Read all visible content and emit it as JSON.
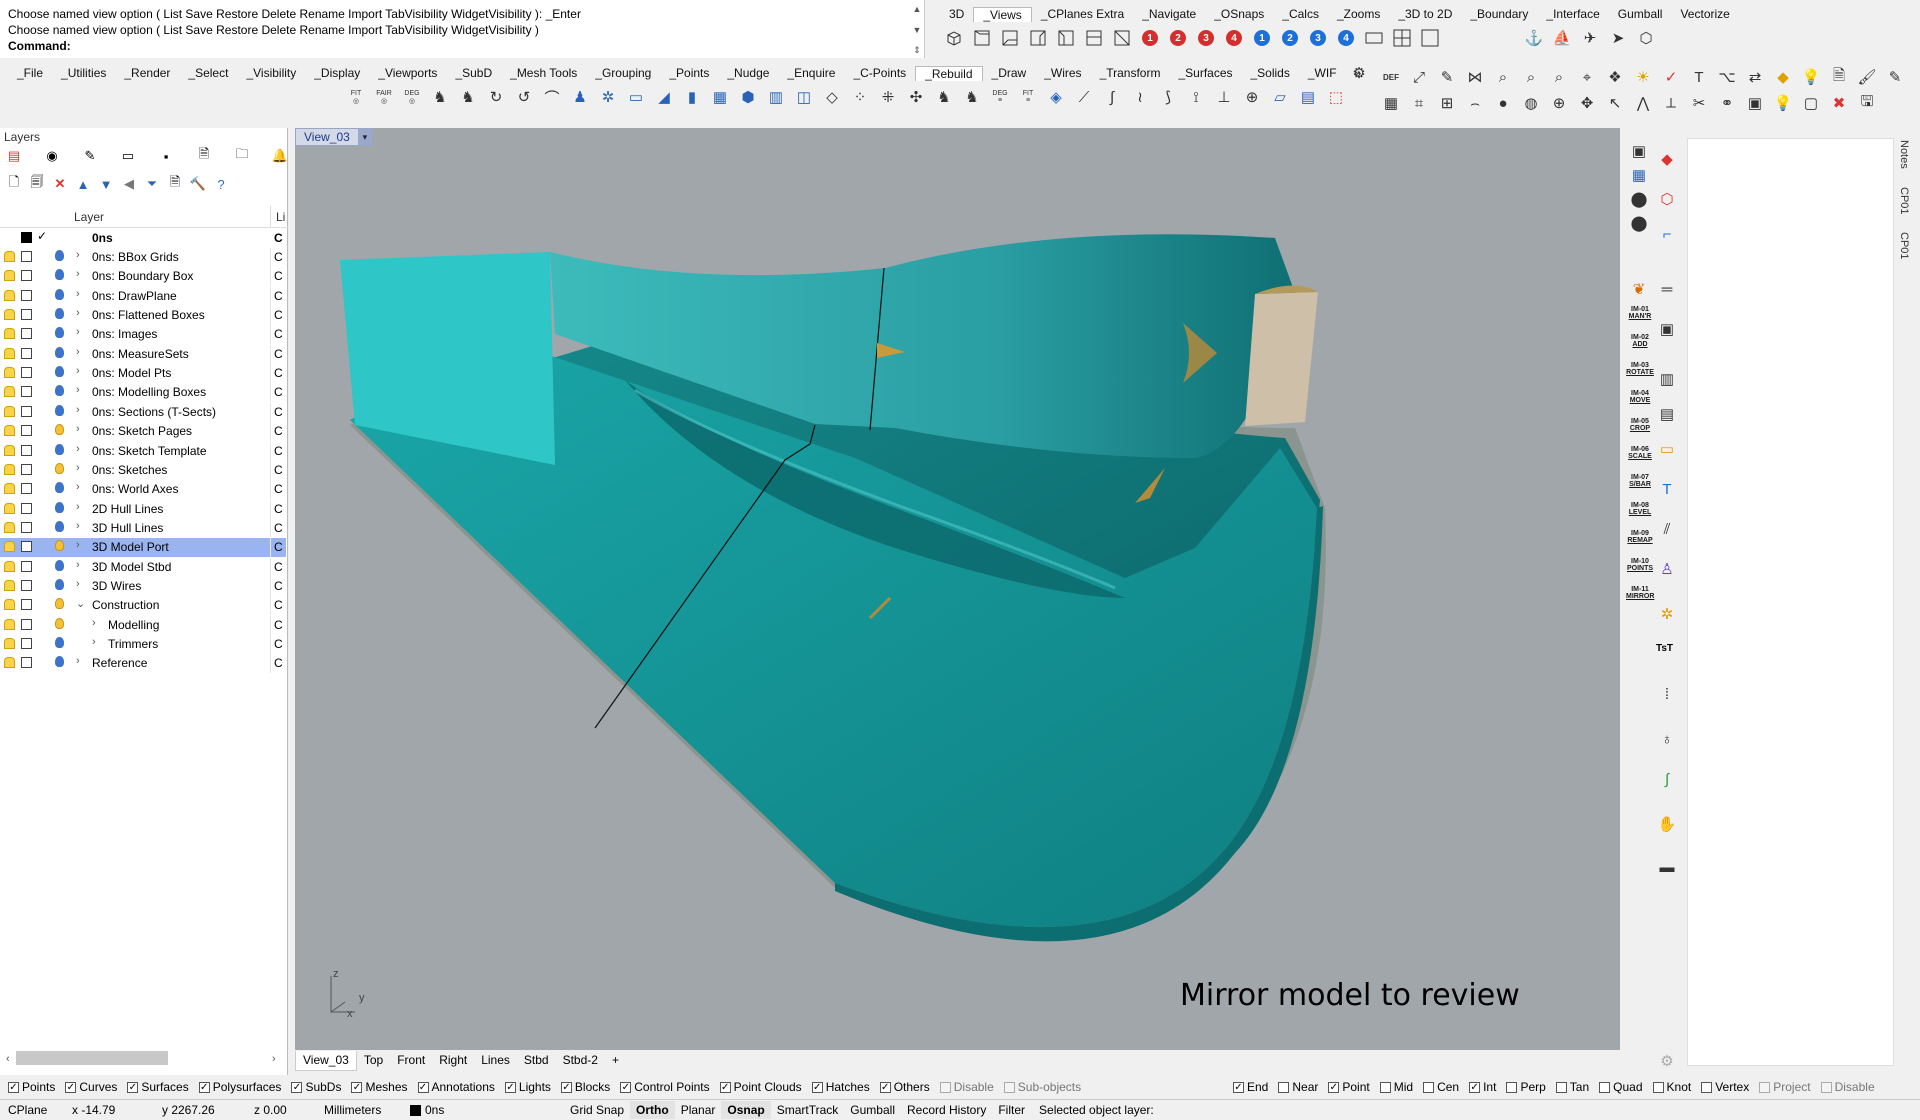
{
  "command": {
    "line1": "Choose named view option ( List  Save  Restore  Delete  Rename  Import  TabVisibility  WidgetVisibility ): _Enter",
    "line2": "Choose named view option ( List  Save  Restore  Delete  Rename  Import  TabVisibility  WidgetVisibility )",
    "prompt": "Command:"
  },
  "top_tabs": [
    "3D",
    "_Views",
    "_CPlanes Extra",
    "_Navigate",
    "_OSnaps",
    "_Calcs",
    "_Zooms",
    "_3D to 2D",
    "_Boundary",
    "_Interface",
    "Gumball",
    "Vectorize"
  ],
  "top_tabs_active": "_Views",
  "main_tabs": [
    "_File",
    "_Utilities",
    "_Render",
    "_Select",
    "_Visibility",
    "_Display",
    "_Viewports",
    "_SubD",
    "_Mesh Tools",
    "_Grouping",
    "_Points",
    "_Nudge",
    "_Enquire",
    "_C-Points",
    "_Rebuild",
    "_Draw",
    "_Wires",
    "_Transform",
    "_Surfaces",
    "_Solids",
    "_WIF"
  ],
  "main_tabs_active": "_Rebuild",
  "toolbar_small_labels": [
    "FIT",
    "FAIR",
    "DEG"
  ],
  "toolbar_labels2": [
    "DEG",
    "FIT"
  ],
  "right_toolbar_label": "DEF",
  "layers": {
    "title": "Layers",
    "col_layer": "Layer",
    "col_material": "Li",
    "current_layer": "0ns",
    "rows": [
      {
        "name": "0ns: BBox Grids",
        "bulb": "blue",
        "indent": 0,
        "exp": "›"
      },
      {
        "name": "0ns: Boundary Box",
        "bulb": "blue",
        "indent": 0,
        "exp": "›"
      },
      {
        "name": "0ns: DrawPlane",
        "bulb": "blue",
        "indent": 0,
        "exp": "›"
      },
      {
        "name": "0ns: Flattened Boxes",
        "bulb": "blue",
        "indent": 0,
        "exp": "›"
      },
      {
        "name": "0ns: Images",
        "bulb": "blue",
        "indent": 0,
        "exp": "›"
      },
      {
        "name": "0ns: MeasureSets",
        "bulb": "blue",
        "indent": 0,
        "exp": "›"
      },
      {
        "name": "0ns: Model Pts",
        "bulb": "blue",
        "indent": 0,
        "exp": "›"
      },
      {
        "name": "0ns: Modelling Boxes",
        "bulb": "blue",
        "indent": 0,
        "exp": "›"
      },
      {
        "name": "0ns: Sections (T-Sects)",
        "bulb": "blue",
        "indent": 0,
        "exp": "›"
      },
      {
        "name": "0ns: Sketch Pages",
        "bulb": "yel",
        "indent": 0,
        "exp": "›"
      },
      {
        "name": "0ns: Sketch Template",
        "bulb": "blue",
        "indent": 0,
        "exp": "›"
      },
      {
        "name": "0ns: Sketches",
        "bulb": "yel",
        "indent": 0,
        "exp": "›"
      },
      {
        "name": "0ns: World Axes",
        "bulb": "blue",
        "indent": 0,
        "exp": "›"
      },
      {
        "name": "2D Hull Lines",
        "bulb": "blue",
        "indent": 0,
        "exp": "›"
      },
      {
        "name": "3D Hull Lines",
        "bulb": "blue",
        "indent": 0,
        "exp": "›"
      },
      {
        "name": "3D Model Port",
        "bulb": "yel",
        "indent": 0,
        "exp": "›",
        "selected": true
      },
      {
        "name": "3D Model Stbd",
        "bulb": "blue",
        "indent": 0,
        "exp": "›"
      },
      {
        "name": "3D Wires",
        "bulb": "blue",
        "indent": 0,
        "exp": "›"
      },
      {
        "name": "Construction",
        "bulb": "yel",
        "indent": 0,
        "exp": "⌄"
      },
      {
        "name": "Modelling",
        "bulb": "yel",
        "indent": 1,
        "exp": "›"
      },
      {
        "name": "Trimmers",
        "bulb": "blue",
        "indent": 1,
        "exp": "›"
      },
      {
        "name": "Reference",
        "bulb": "blue",
        "indent": 0,
        "exp": "›"
      }
    ],
    "material_abbrev": "C"
  },
  "viewport": {
    "name": "View_03",
    "caption": "Mirror model to review",
    "axis_z": "z",
    "axis_x": "x",
    "axis_y": "y",
    "tabs": [
      "View_03",
      "Top",
      "Front",
      "Right",
      "Lines",
      "Stbd",
      "Stbd-2"
    ],
    "add_tab": "+"
  },
  "right_strip_labels": [
    [
      "IM-01",
      "MAN'R"
    ],
    [
      "IM-02",
      "ADD"
    ],
    [
      "IM-03",
      "ROTATE"
    ],
    [
      "IM-04",
      "MOVE"
    ],
    [
      "IM-05",
      "CROP"
    ],
    [
      "IM-06",
      "SCALE"
    ],
    [
      "IM-07",
      "S/BAR"
    ],
    [
      "IM-08",
      "LEVEL"
    ],
    [
      "IM-09",
      "REMAP"
    ],
    [
      "IM-10",
      "POINTS"
    ],
    [
      "IM-11",
      "MIRROR"
    ]
  ],
  "right_strip_text": "TsT",
  "side_tabs": [
    "Notes",
    "CP01",
    "CP01"
  ],
  "filters": [
    {
      "label": "Points",
      "checked": true
    },
    {
      "label": "Curves",
      "checked": true
    },
    {
      "label": "Surfaces",
      "checked": true
    },
    {
      "label": "Polysurfaces",
      "checked": true
    },
    {
      "label": "SubDs",
      "checked": true
    },
    {
      "label": "Meshes",
      "checked": true
    },
    {
      "label": "Annotations",
      "checked": true
    },
    {
      "label": "Lights",
      "checked": true
    },
    {
      "label": "Blocks",
      "checked": true
    },
    {
      "label": "Control Points",
      "checked": true
    },
    {
      "label": "Point Clouds",
      "checked": true
    },
    {
      "label": "Hatches",
      "checked": true
    },
    {
      "label": "Others",
      "checked": true
    },
    {
      "label": "Disable",
      "checked": false,
      "disabled": true
    },
    {
      "label": "Sub-objects",
      "checked": false,
      "disabled": true
    }
  ],
  "osnaps": [
    {
      "label": "End",
      "checked": true
    },
    {
      "label": "Near",
      "checked": false
    },
    {
      "label": "Point",
      "checked": true
    },
    {
      "label": "Mid",
      "checked": false
    },
    {
      "label": "Cen",
      "checked": false
    },
    {
      "label": "Int",
      "checked": true
    },
    {
      "label": "Perp",
      "checked": false
    },
    {
      "label": "Tan",
      "checked": false
    },
    {
      "label": "Quad",
      "checked": false
    },
    {
      "label": "Knot",
      "checked": false
    },
    {
      "label": "Vertex",
      "checked": false
    },
    {
      "label": "Project",
      "checked": false,
      "disabled": true
    },
    {
      "label": "Disable",
      "checked": false,
      "disabled": true
    }
  ],
  "status": {
    "cplane": "CPlane",
    "x": "x -14.79",
    "y": "y 2267.26",
    "z": "z 0.00",
    "units": "Millimeters",
    "layer": "0ns",
    "buttons": [
      {
        "label": "Grid Snap",
        "on": false
      },
      {
        "label": "Ortho",
        "on": true
      },
      {
        "label": "Planar",
        "on": false
      },
      {
        "label": "Osnap",
        "on": true
      },
      {
        "label": "SmartTrack",
        "on": false
      },
      {
        "label": "Gumball",
        "on": false
      },
      {
        "label": "Record History",
        "on": false
      },
      {
        "label": "Filter",
        "on": false
      }
    ],
    "message": "Selected object layer:"
  },
  "colors": {
    "viewport_bg": "#a1a6ab",
    "hull_teal": "#1a9ea0",
    "hull_light": "#2ec6c6",
    "selection": "#99b4f0",
    "transom": "#cdbfa8"
  }
}
